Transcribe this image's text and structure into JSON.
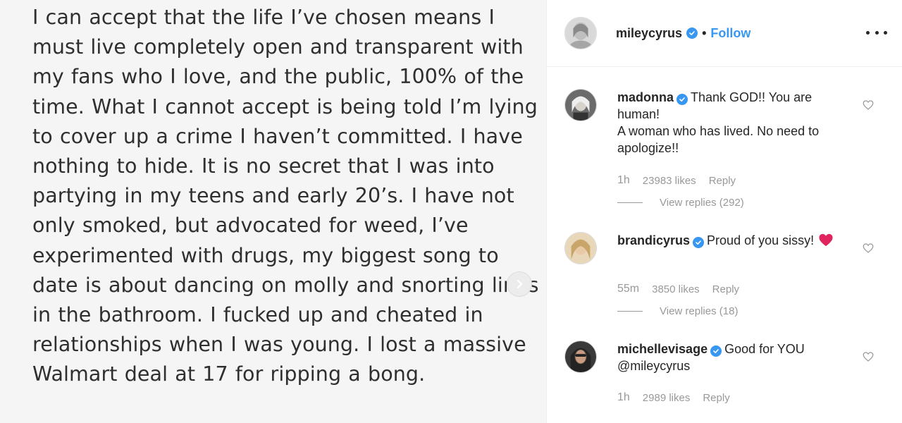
{
  "post": {
    "text": "I can accept that the life I’ve chosen means I must live completely open and transparent with my fans who I love, and the public, 100% of the time. What I cannot accept is being told I’m lying to cover up a crime I haven’t committed. I have nothing to hide. It is no secret that I was into partying in my teens and early 20’s. I have not only smoked, but advocated for weed, I’ve experimented with drugs, my biggest song to date is about dancing on molly and snorting lines in the bathroom. I fucked up and cheated in relationships when I was young. I lost a massive Walmart deal at 17 for ripping a bong.",
    "next_icon": "chevron-right-icon"
  },
  "header": {
    "username": "mileycyrus",
    "dot": "•",
    "follow_label": "Follow",
    "more_icon": "more-horizontal-icon"
  },
  "comments": [
    {
      "username": "madonna",
      "text": "Thank GOD!! You are human!\nA woman who has lived. No need to apologize!!",
      "time": "1h",
      "likes": "23983 likes",
      "reply_label": "Reply",
      "view_replies": "View replies (292)"
    },
    {
      "username": "brandicyrus",
      "text": "Proud of you sissy!",
      "emoji": "red-heart-emoji",
      "time": "55m",
      "likes": "3850 likes",
      "reply_label": "Reply",
      "view_replies": "View replies (18)"
    },
    {
      "username": "michellevisage",
      "text": "Good for YOU @mileycyrus",
      "time": "1h",
      "likes": "2989 likes",
      "reply_label": "Reply"
    }
  ],
  "colors": {
    "accent": "#3897f0",
    "muted": "#999999",
    "heart": "#ed4956"
  }
}
